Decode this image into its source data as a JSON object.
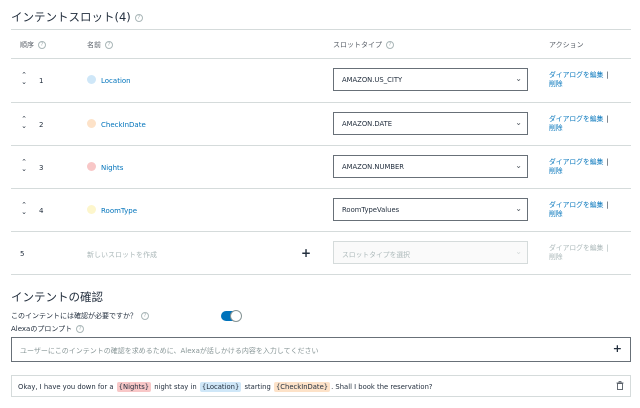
{
  "slots_section": {
    "title": "インテントスロット(4)",
    "help": "?",
    "headers": {
      "order": "順序",
      "name": "名前",
      "slot_type": "スロットタイプ",
      "actions": "アクション"
    }
  },
  "slots": [
    {
      "order": "1",
      "name": "Location",
      "dot_color": "#cfe7f8",
      "type": "AMAZON.US_CITY",
      "edit": "ダイアログを編集",
      "delete": "削除"
    },
    {
      "order": "2",
      "name": "CheckInDate",
      "dot_color": "#fde2c8",
      "type": "AMAZON.DATE",
      "edit": "ダイアログを編集",
      "delete": "削除"
    },
    {
      "order": "3",
      "name": "Nights",
      "dot_color": "#f8c7c7",
      "type": "AMAZON.NUMBER",
      "edit": "ダイアログを編集",
      "delete": "削除"
    },
    {
      "order": "4",
      "name": "RoomType",
      "dot_color": "#fdf6cc",
      "type": "RoomTypeValues",
      "edit": "ダイアログを編集",
      "delete": "削除"
    }
  ],
  "new_slot": {
    "order": "5",
    "placeholder": "新しいスロットを作成",
    "add": "+",
    "type_placeholder": "スロットタイプを選択",
    "edit": "ダイアログを編集",
    "delete": "削除"
  },
  "confirmation": {
    "title": "インテントの確認",
    "question": "このインテントには確認が必要ですか？",
    "toggle_on": true,
    "prompt_label": "Alexaのプロンプト",
    "prompt_placeholder": "ユーザーにこのインテントの確認を求めるために、Alexaが話しかける内容を入力してください",
    "prompt_add": "+"
  },
  "utterance": {
    "part1": "Okay, I have you down for a",
    "slot1": "{Nights}",
    "part2": "night stay in",
    "slot2": "{Location}",
    "part3": "starting",
    "slot3": "{CheckInDate}",
    "part4": ". Shall I book the reservation?"
  },
  "icons": {
    "sort": "sort-arrows-icon",
    "chevron": "chevron-down-icon",
    "trash": "trash-icon",
    "help": "help-circle-icon"
  },
  "colors": {
    "link": "#0073bb",
    "toggle": "#0073bb",
    "nights_tag": "#f8c7c7",
    "location_tag": "#cfe7f8",
    "checkin_tag": "#fde2c8"
  }
}
